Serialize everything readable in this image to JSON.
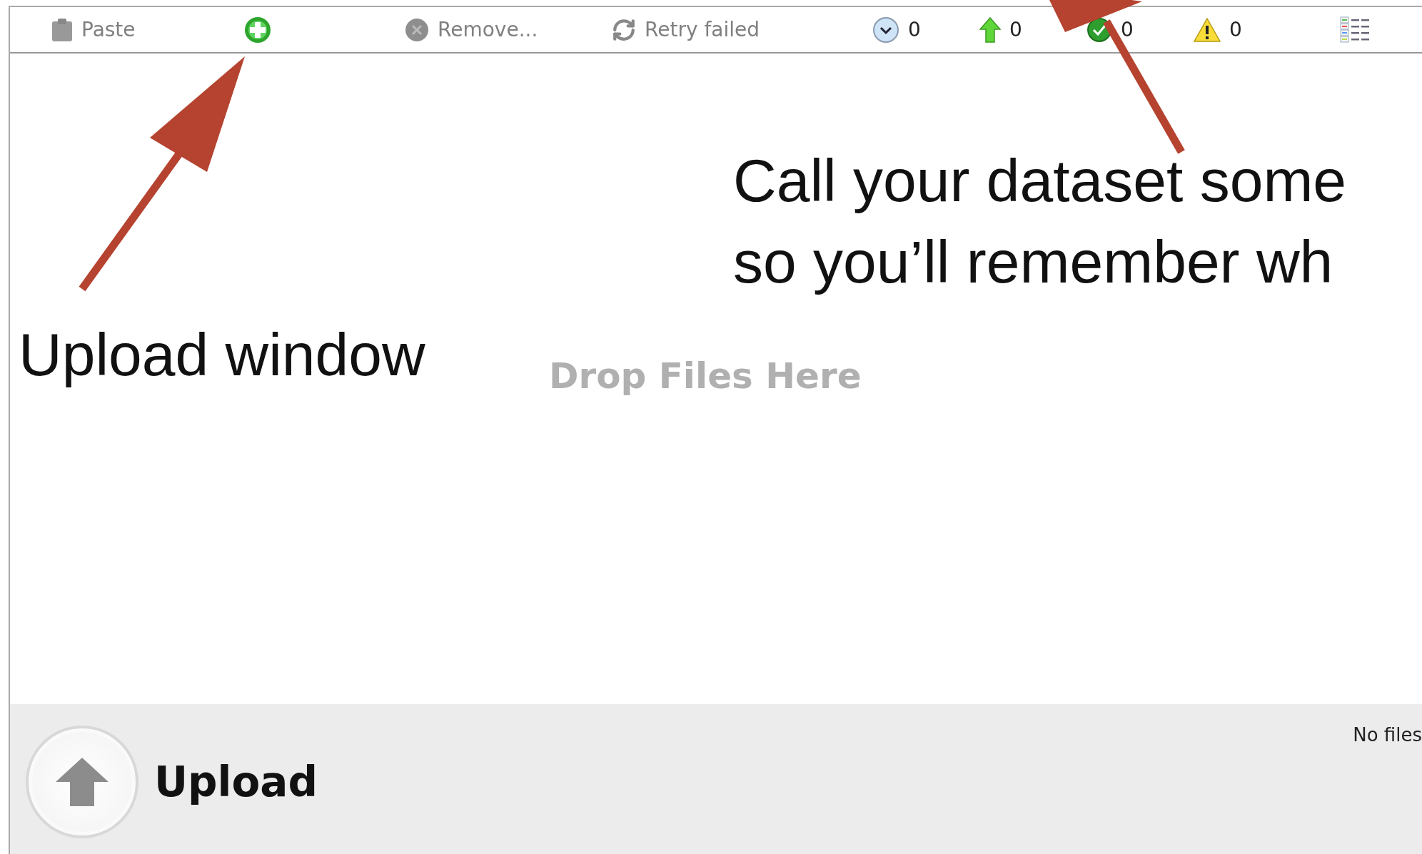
{
  "toolbar": [
    {
      "kind": "paste",
      "label": "Paste",
      "disabled": true
    },
    {
      "kind": "add"
    },
    {
      "kind": "remove",
      "label": "Remove...",
      "disabled": true
    },
    {
      "kind": "retry",
      "label": "Retry failed",
      "disabled": true
    },
    {
      "kind": "queued",
      "count": "0"
    },
    {
      "kind": "uploading",
      "count": "0"
    },
    {
      "kind": "done",
      "count": "0"
    },
    {
      "kind": "error",
      "count": "0"
    },
    {
      "kind": "list"
    }
  ],
  "drop_zone": {
    "text": "Drop Files Here"
  },
  "footer": {
    "button": "Upload",
    "status": "No files"
  },
  "annotations": [
    {
      "kind": "right",
      "lines": [
        "Call your dataset some",
        "so you’ll remember wh"
      ]
    },
    {
      "kind": "left",
      "lines": [
        "Upload window"
      ]
    }
  ]
}
